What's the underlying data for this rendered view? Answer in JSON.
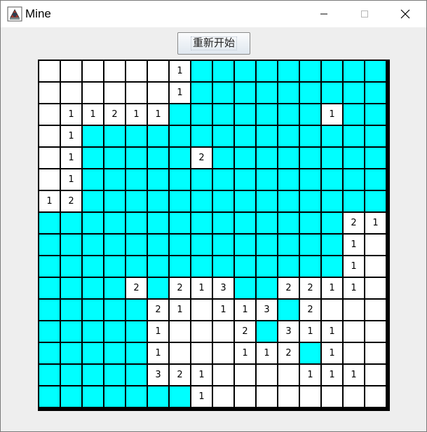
{
  "window": {
    "title": "Mine",
    "minimize_icon": "minimize-icon",
    "maximize_icon": "maximize-icon",
    "close_icon": "close-icon"
  },
  "toolbar": {
    "restart_label": "重新开始"
  },
  "colors": {
    "covered": "#00ffff",
    "revealed": "#ffffff",
    "gridline": "#000000"
  },
  "board": {
    "rows": 16,
    "cols": 16,
    "legend": "C = covered cell (cyan), . = revealed empty, digit = revealed number",
    "cells": [
      "......1CCCCCCCCC",
      "......1CCCCCCCCC",
      ".11211CCCCCCC1CC",
      ".1CCCCCCCCCCCCCC",
      ".1CCCCC2CCCCCCCC",
      ".1CCCCCCCCCCCCCC",
      "12CCCCCCCCCCCCCC",
      "CCCCCCCCCCCCCC21",
      "CCCCCCCCCCCCCC1.",
      "CCCCCCCCCCCCCC1.",
      "CCCC2C213CC2211.",
      "CCCCC21.113C2...",
      "CCCCC1...2C311..",
      "CCCCC1...112C1..",
      "CCCCC321....111.",
      "CCCCCCC1........"
    ]
  }
}
